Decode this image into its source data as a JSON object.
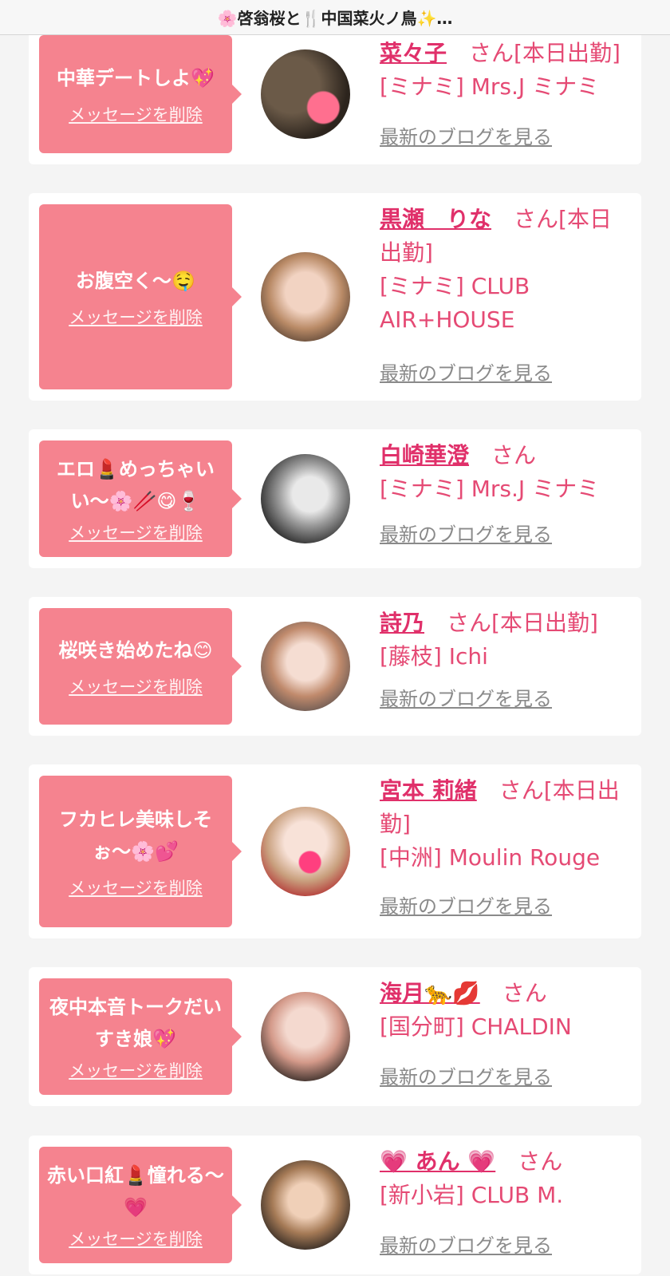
{
  "header": {
    "title": "🌸啓翁桜と🍴中国菜火ノ鳥✨…"
  },
  "actions": {
    "delete_label": "メッセージを削除",
    "blog_label": "最新のブログを見る"
  },
  "colors": {
    "accent": "#f5838f",
    "name": "#e0306a",
    "text": "#e54a74",
    "link_gray": "#8a8a8a"
  },
  "cards": [
    {
      "message": "中華デートしよ💖",
      "name": "菜々子",
      "suffix": "さん[本日出勤]",
      "shop": "[ミナミ] Mrs.J ミナミ"
    },
    {
      "message": "お腹空く〜🤤",
      "name": "黒瀬　りな",
      "suffix": "さん[本日出勤]",
      "shop": "[ミナミ] CLUB AIR+HOUSE"
    },
    {
      "message": "エロ💄めっちゃいい〜🌸🥢😋🍷",
      "name": "白崎華澄",
      "suffix": "さん",
      "shop": "[ミナミ] Mrs.J ミナミ"
    },
    {
      "message": "桜咲き始めたね😊",
      "name": "詩乃",
      "suffix": "さん[本日出勤]",
      "shop": "[藤枝] Ichi"
    },
    {
      "message": "フカヒレ美味しそぉ〜🌸💕",
      "name": "宮本 莉緒",
      "suffix": "さん[本日出勤]",
      "shop": "[中洲] Moulin Rouge"
    },
    {
      "message": "夜中本音トークだいすき娘💖",
      "name": "海月🐆💋",
      "suffix": "さん",
      "shop": "[国分町] CHALDIN"
    },
    {
      "message": "赤い口紅💄憧れる〜💗",
      "name": "💗 あん 💗",
      "suffix": "さん",
      "shop": "[新小岩] CLUB M."
    }
  ]
}
